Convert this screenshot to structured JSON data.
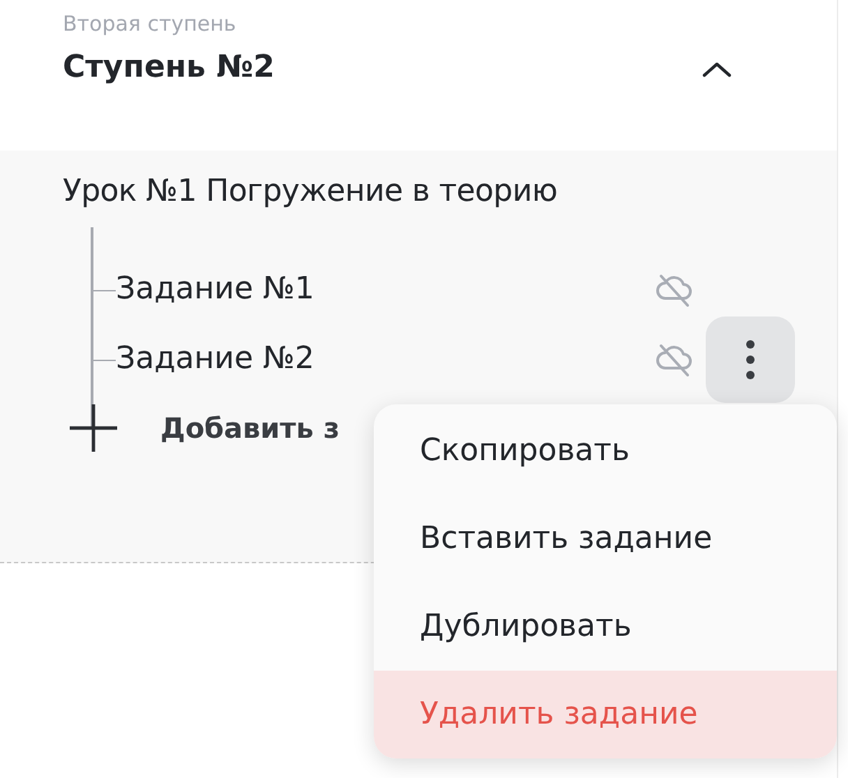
{
  "stage": {
    "subtitle": "Вторая ступень",
    "title": "Ступень №2",
    "expanded": true
  },
  "lesson": {
    "title": "Урок №1 Погружение в теорию",
    "tasks": [
      {
        "label": "Задание №1",
        "synced": false,
        "menu_open": false
      },
      {
        "label": "Задание №2",
        "synced": false,
        "menu_open": true
      }
    ],
    "add_label": "Добавить з"
  },
  "context_menu": {
    "items": [
      {
        "label": "Скопировать",
        "kind": "normal",
        "highlighted": false
      },
      {
        "label": "Вставить задание",
        "kind": "normal",
        "highlighted": false
      },
      {
        "label": "Дублировать",
        "kind": "normal",
        "highlighted": false
      },
      {
        "label": "Удалить задание",
        "kind": "danger",
        "highlighted": true
      }
    ]
  }
}
